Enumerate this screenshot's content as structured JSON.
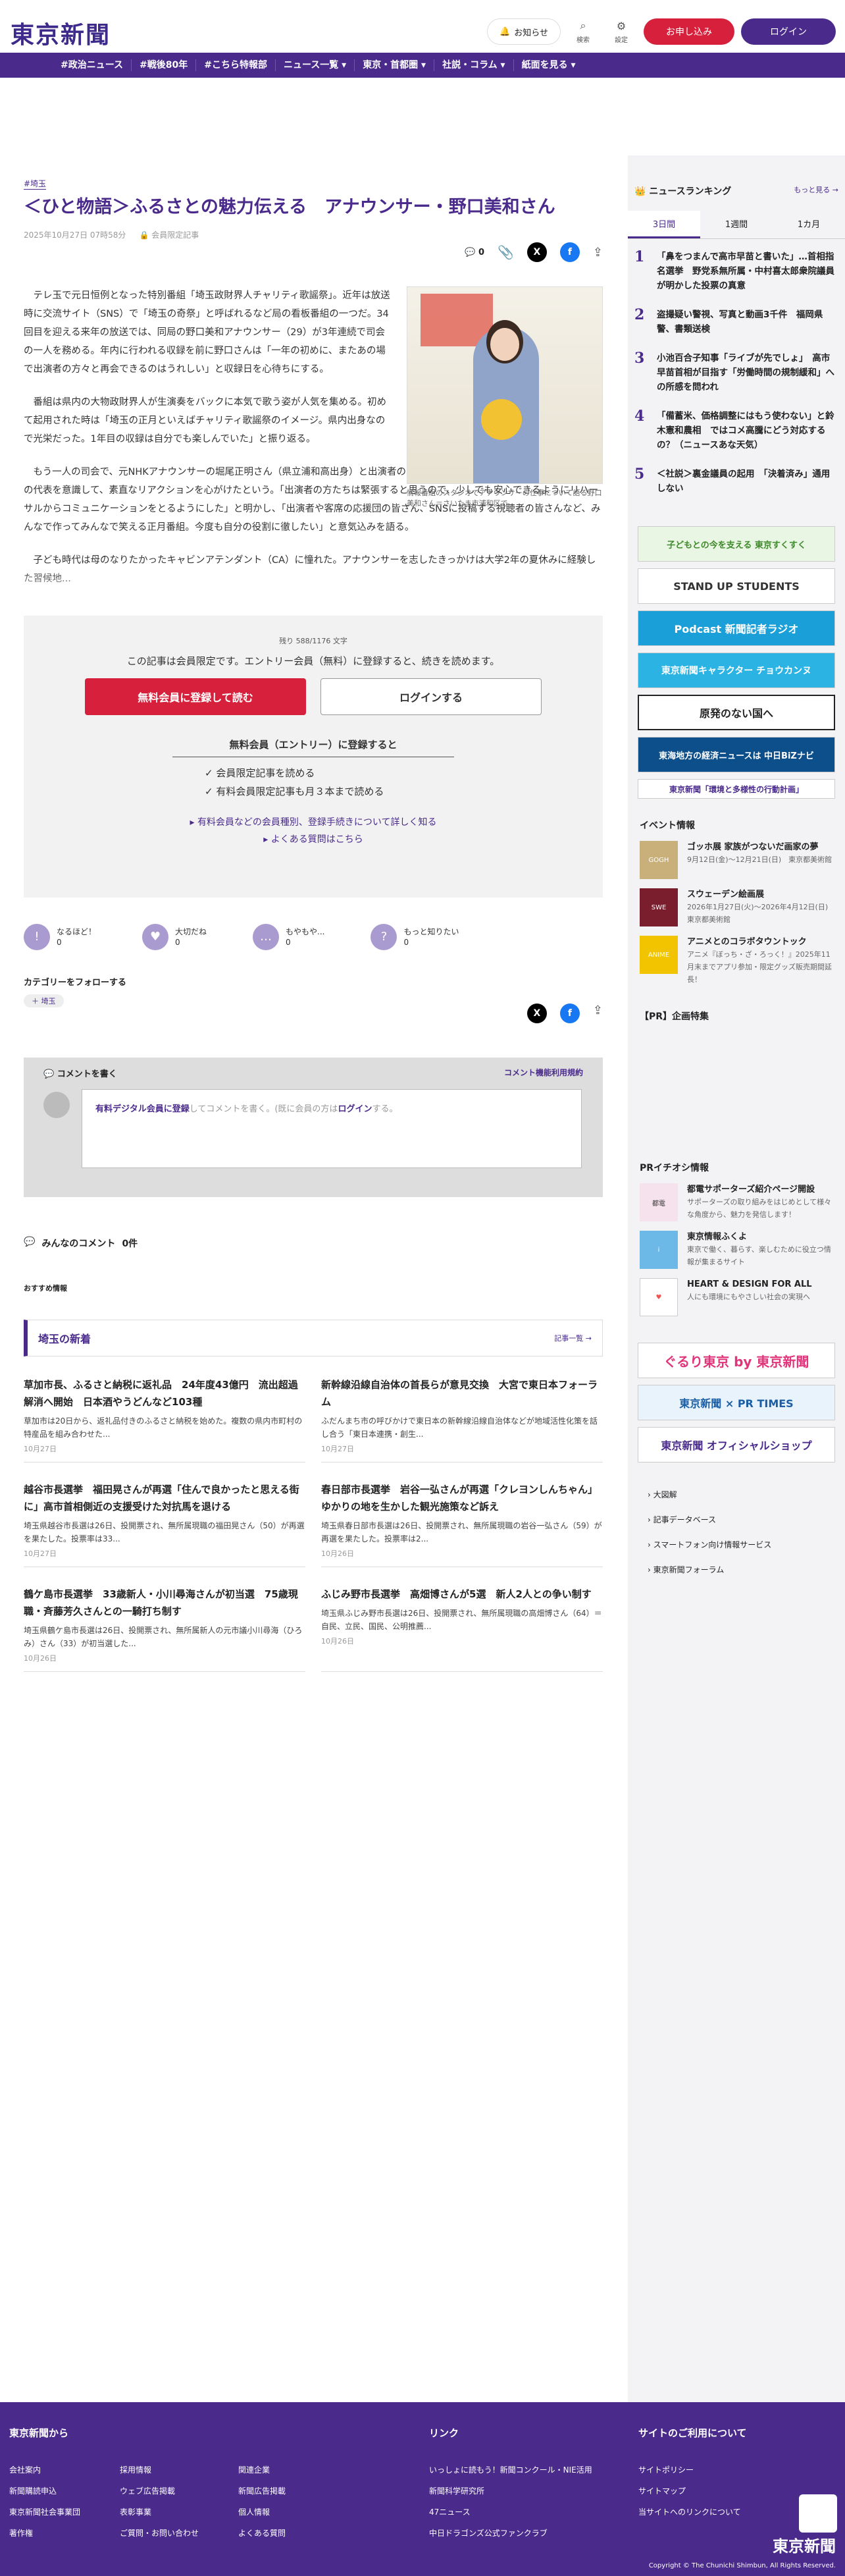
{
  "header": {
    "logo": "東京新聞",
    "notify": "お知らせ",
    "search": "検索",
    "settings": "設定",
    "signup": "お申し込み",
    "login": "ログイン"
  },
  "nav": [
    "#政治ニュース",
    "#戦後80年",
    "#こちら特報部",
    "ニュース一覧 ▾",
    "東京・首都圏 ▾",
    "社説・コラム ▾",
    "紙面を見る ▾"
  ],
  "article": {
    "tag": "#埼玉",
    "title": "＜ひと物語＞ふるさとの魅力伝える　アナウンサー・野口美和さん",
    "date": "2025年10月27日 07時58分",
    "member": "会員限定記事",
    "comment_count": "0",
    "paragraphs": [
      "テレ玉で元日恒例となった特別番組「埼玉政財界人チャリティ歌謡祭」。近年は放送時に交流サイト（SNS）で「埼玉の奇祭」と呼ばれるなど局の看板番組の一つだ。34回目を迎える来年の放送では、同局の野口美和アナウンサー（29）が3年連続で司会の一人を務める。年内に行われる収録を前に野口さんは「一年の初めに、またあの場で出演者の方々と再会できるのはうれしい」と収録日を心待ちにする。",
      "番組は県内の大物政財界人が生演奏をバックに本気で歌う姿が人気を集める。初めて起用された時は「埼玉の正月といえばチャリティ歌謡祭のイメージ。県内出身なので光栄だった。1年目の収録は自分でも楽しんでいた」と振り返る。",
      "もう一人の司会で、元NHKアナウンサーの堀尾正明さん（県立浦和高出身）と出演者のやりとりも番組名物の一つだ。2年目は視聴者の代表を意識して、素直なリアクションを心がけたという。「出演者の方たちは緊張すると思うので、少しでも安心できるようにリハーサルからコミュニケーションをとるようにした」と明かし、「出演者や客席の応援団の皆さん、SNSに投稿する視聴者の皆さんなど、みんなで作ってみんなで笑える正月番組。今度も自分の役割に徹したい」と意気込みを語る。",
      "子ども時代は母のなりたかったキャビンアテンダント（CA）に憧れた。アナウンサーを志したきっかけは大学2年の夏休みに経験した習候地..."
    ],
    "photo_caption": "情報番組のスタジオでアナウンサーの仕事について語る野口美和さん＝さいたま市浦和区で"
  },
  "paywall": {
    "count": "残り 588/1176 文字",
    "message": "この記事は会員限定です。エントリー会員（無料）に登録すると、続きを読めます。",
    "register": "無料会員に登録して読む",
    "login": "ログインする",
    "heading": "無料会員（エントリー）に登録すると",
    "check1": "会員限定記事を読める",
    "check2": "有料会員限定記事も月３本まで読める",
    "link1": "有料会員などの会員種別、登録手続きについて詳しく知る",
    "link2": "よくある質問はこちら"
  },
  "reactions": [
    {
      "label": "なるほど！",
      "n": "0",
      "icon": "!"
    },
    {
      "label": "大切だね",
      "n": "0",
      "icon": "♥"
    },
    {
      "label": "もやもや...",
      "n": "0",
      "icon": "…"
    },
    {
      "label": "もっと知りたい",
      "n": "0",
      "icon": "?"
    }
  ],
  "follow": {
    "label": "カテゴリーをフォローする",
    "chip": "＋ 埼玉"
  },
  "comment": {
    "title": "コメントを書く",
    "rule": "コメント機能利用規約",
    "placeholder_a": "有料デジタル会員に登録",
    "placeholder_b": "してコメントを書く。(既に会員の方は",
    "placeholder_c": "ログイン",
    "placeholder_d": "する。",
    "all": "みんなのコメント",
    "all_n": "0件"
  },
  "recommend": "おすすめ情報",
  "related": {
    "title": "埼玉の新着",
    "more": "記事一覧 →",
    "items": [
      {
        "t": "草加市長、ふるさと納税に返礼品　24年度43億円　流出超過解消へ開始　日本酒やうどんなど103種",
        "p": "草加市は20日から、返礼品付きのふるさと納税を始めた。複数の県内市町村の特産品を組み合わせた...",
        "d": "10月27日"
      },
      {
        "t": "新幹線沿線自治体の首長らが意見交換　大宮で東日本フォーラム",
        "p": "ふだんまち市の呼びかけで東日本の新幹線沿線自治体などが地域活性化策を話し合う「東日本連携・創生...",
        "d": "10月27日"
      },
      {
        "t": "越谷市長選挙　福田晃さんが再選「住んで良かったと思える街に」高市首相側近の支援受けた対抗馬を退ける",
        "p": "埼玉県越谷市長選は26日、投開票され、無所属現職の福田晃さん（50）が再選を果たした。投票率は33...",
        "d": "10月27日"
      },
      {
        "t": "春日部市長選挙　岩谷一弘さんが再選「クレヨンしんちゃん」ゆかりの地を生かした観光施策など訴え",
        "p": "埼玉県春日部市長選は26日、投開票され、無所属現職の岩谷一弘さん（59）が再選を果たした。投票率は2...",
        "d": "10月26日"
      },
      {
        "t": "鶴ケ島市長選挙　33歳新人・小川尋海さんが初当選　75歳現職・斉藤芳久さんとの一騎打ち制す",
        "p": "埼玉県鶴ケ島市長選は26日、投開票され、無所属新人の元市議小川尋海（ひろみ）さん（33）が初当選した...",
        "d": "10月26日"
      },
      {
        "t": "ふじみ野市長選挙　高畑博さんが5選　新人2人との争い制す",
        "p": "埼玉県ふじみ野市長選は26日、投開票され、無所属現職の高畑博さん（64）＝自民、立民、国民、公明推薦...",
        "d": "10月26日"
      }
    ]
  },
  "ranking": {
    "title": "ニュースランキング",
    "more": "もっと見る →",
    "tabs": [
      "3日間",
      "1週間",
      "1カ月"
    ],
    "items": [
      "「鼻をつまんで高市早苗と書いた」…首相指名選挙　野党系無所属・中村喜太郎衆院議員が明かした投票の真意",
      "盗撮疑い警視、写真と動画3千件　福岡県警、書類送検",
      "小池百合子知事「ライブが先でしょ」　高市早苗首相が目指す「労働時間の規制緩和」への所感を問われ",
      "「備蓄米、価格調整にはもう使わない」と鈴木憲和農相　ではコメ高騰にどう対応するの？（ニュースあな天気）",
      "＜社説＞裏金議員の起用　「決着済み」通用しない"
    ]
  },
  "banners": [
    "子どもとの今を支える 東京すくすく",
    "STAND UP STUDENTS",
    "Podcast 新聞記者ラジオ",
    "東京新聞キャラクター チョウカンヌ",
    "原発のない国へ",
    "東海地方の経済ニュースは 中日BiZナビ",
    "東京新聞「環境と多様性の行動計画」"
  ],
  "events": {
    "title": "イベント情報",
    "items": [
      {
        "b": "ゴッホ展 家族がつないだ画家の夢",
        "s": "9月12日(金)〜12月21日(日)　東京都美術館"
      },
      {
        "b": "スウェーデン絵画展",
        "s": "2026年1月27日(火)〜2026年4月12日(日)　東京都美術館"
      },
      {
        "b": "アニメとのコラボタウントック",
        "s": "アニメ『ぼっち・ざ・ろっく！』2025年11月末までアプリ参加・限定グッズ販売期間延長！"
      }
    ]
  },
  "pr": {
    "title": "【PR】企画特集",
    "it": "PRイチオシ情報",
    "items": [
      {
        "b": "都電サポーターズ紹介ページ開設",
        "s": "サポーターズの取り組みをはじめとして様々な角度から、魅力を発信します！"
      },
      {
        "b": "東京情報ふくよ",
        "s": "東京で働く、暮らす、楽しむために役立つ情報が集まるサイト"
      },
      {
        "b": "HEART & DESIGN FOR ALL",
        "s": "人にも環境にもやさしい社会の実現へ"
      }
    ]
  },
  "side_banners": [
    "ぐるり東京 by 東京新聞",
    "東京新聞 × PR TIMES",
    "東京新聞 オフィシャルショップ"
  ],
  "side_links": [
    "大図解",
    "記事データベース",
    "スマートフォン向け情報サービス",
    "東京新聞フォーラム"
  ],
  "footer": {
    "c1": "東京新聞から",
    "c1a": [
      "会社案内",
      "新聞購読申込",
      "東京新聞社会事業団",
      "著作権"
    ],
    "c1b": [
      "採用情報",
      "ウェブ広告掲載",
      "表彰事業",
      "ご質問・お問い合わせ"
    ],
    "c1c": [
      "関連企業",
      "新聞広告掲載",
      "個人情報",
      "よくある質問"
    ],
    "c2": "リンク",
    "c2a": [
      "いっしょに読もう！新聞コンクール・NIE活用",
      "新聞科学研究所",
      "47ニュース",
      "中日ドラゴンズ公式ファンクラブ"
    ],
    "c3": "サイトのご利用について",
    "c3a": [
      "サイトポリシー",
      "サイトマップ",
      "当サイトへのリンクについて"
    ],
    "logo": "東京新聞",
    "copy": "Copyright © The Chunichi Shimbun, All Rights Reserved."
  },
  "colors": {
    "brand": "#4a2b8c",
    "red": "#d6203c"
  }
}
